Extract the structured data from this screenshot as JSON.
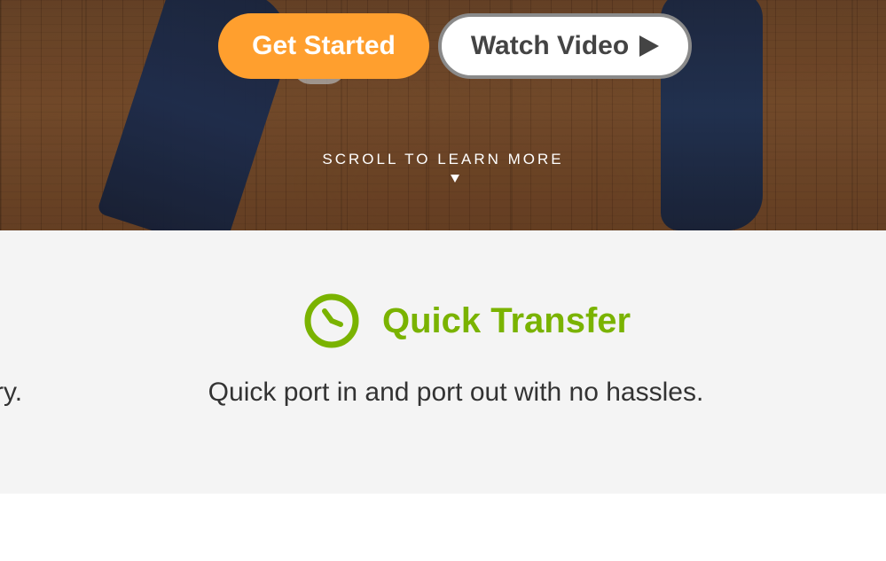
{
  "hero": {
    "cta_primary": "Get Started",
    "cta_secondary": "Watch Video",
    "scroll_hint": "SCROLL TO LEARN MORE",
    "icons": [
      "play-icon",
      "chevron-down-icon"
    ]
  },
  "features": {
    "partial_prev_text": "ry.",
    "current": {
      "icon": "clock-icon",
      "title": "Quick Transfer",
      "description": "Quick port in and port out with no hassles."
    }
  },
  "colors": {
    "primary_orange": "#ff9f2e",
    "accent_green": "#7ab300",
    "text_dark": "#333333",
    "band_bg": "#f4f4f4"
  }
}
